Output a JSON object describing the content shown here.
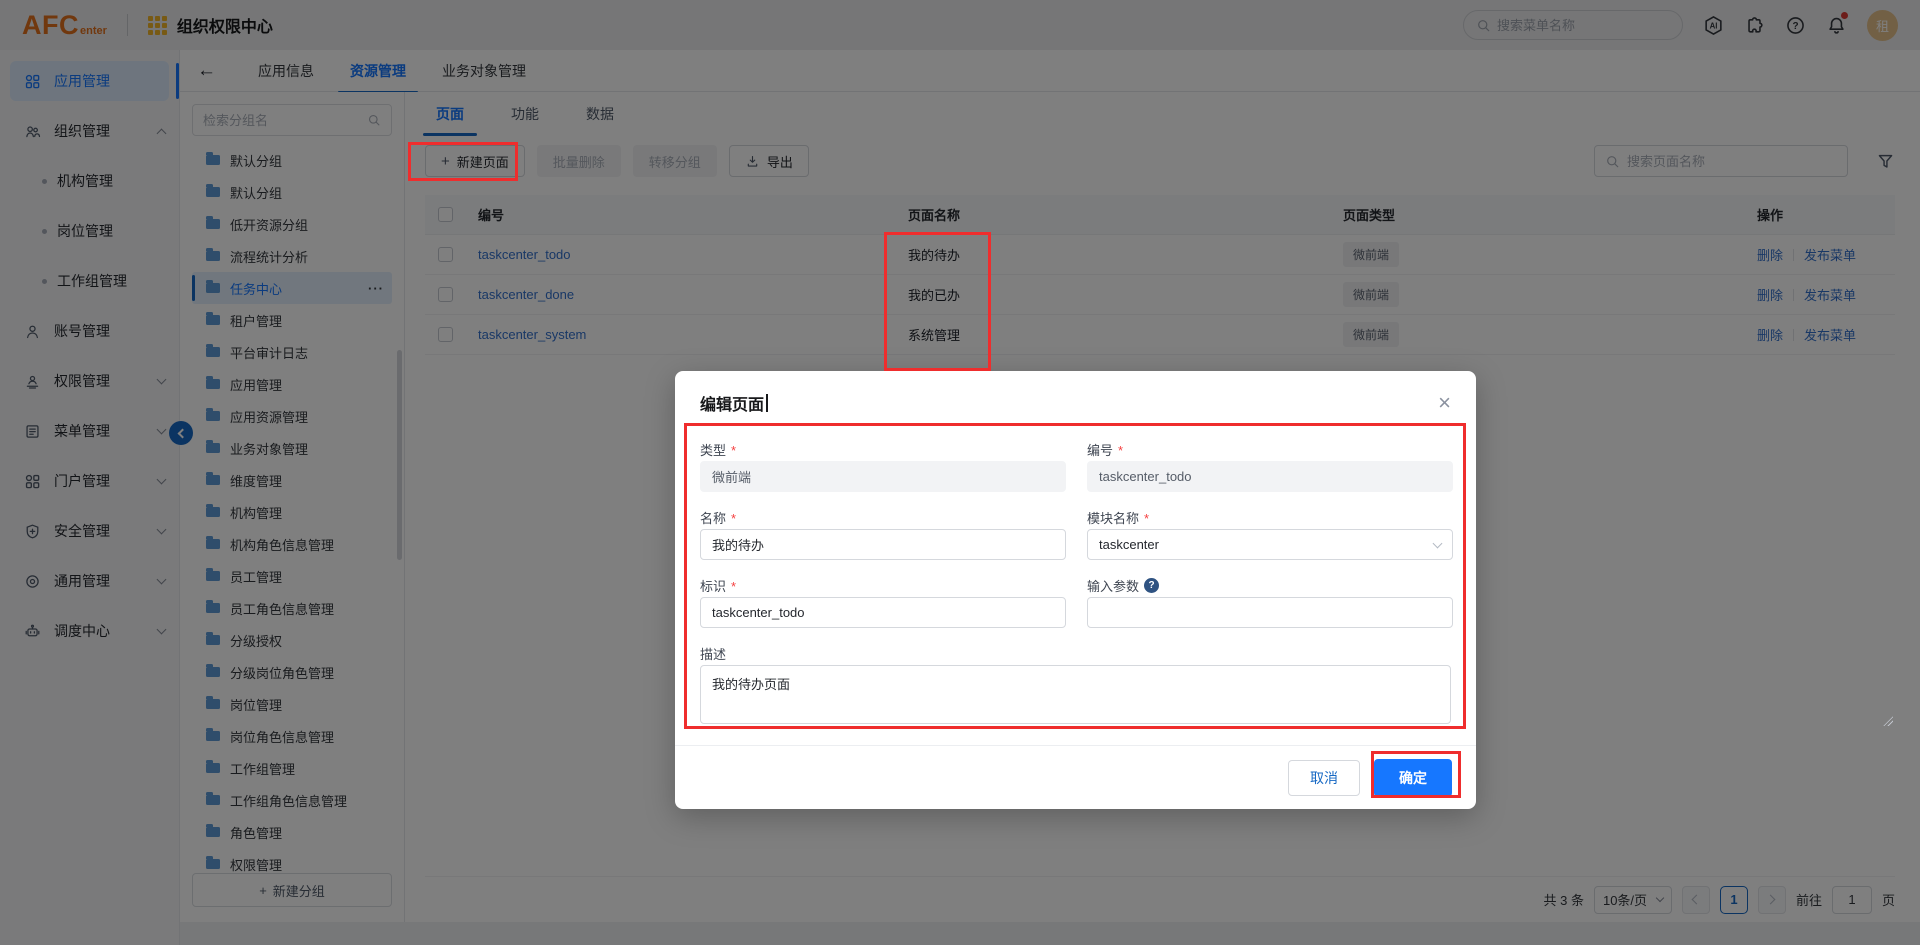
{
  "colors": {
    "accent": "#1677ff",
    "annotation": "#ef2d2d",
    "logo_orange": "#e2711d",
    "grid_gold": "#f0b428",
    "folder_blue": "#5e9bd6",
    "avatar_tan": "#e4c08a"
  },
  "icons": {
    "back": "←",
    "close": "×",
    "plus": "+",
    "more": "···",
    "question_mark": "?",
    "collapse": "chevron-left-circle",
    "search": "magnifier",
    "notification": "bell",
    "help": "question-circle",
    "plugin": "puzzle",
    "assistant": "ai-hexagon",
    "filter": "funnel",
    "export": "download-arrow"
  },
  "header": {
    "logo_afc": "AFC",
    "logo_enter": "enter",
    "app_title": "组织权限中心",
    "search_placeholder": "搜索菜单名称",
    "avatar_text": "租"
  },
  "sidebar": {
    "items": [
      {
        "label": "应用管理"
      },
      {
        "label": "组织管理"
      },
      {
        "label": "机构管理"
      },
      {
        "label": "岗位管理"
      },
      {
        "label": "工作组管理"
      },
      {
        "label": "账号管理"
      },
      {
        "label": "权限管理"
      },
      {
        "label": "菜单管理"
      },
      {
        "label": "门户管理"
      },
      {
        "label": "安全管理"
      },
      {
        "label": "通用管理"
      },
      {
        "label": "调度中心"
      }
    ]
  },
  "tabs": [
    "应用信息",
    "资源管理",
    "业务对象管理"
  ],
  "panel": {
    "search_placeholder": "检索分组名",
    "groups": [
      "默认分组",
      "默认分组",
      "低开资源分组",
      "流程统计分析",
      "任务中心",
      "租户管理",
      "平台审计日志",
      "应用管理",
      "应用资源管理",
      "业务对象管理",
      "维度管理",
      "机构管理",
      "机构角色信息管理",
      "员工管理",
      "员工角色信息管理",
      "分级授权",
      "分级岗位角色管理",
      "岗位管理",
      "岗位角色信息管理",
      "工作组管理",
      "工作组角色信息管理",
      "角色管理",
      "权限管理"
    ],
    "selected": "任务中心",
    "new_group": "新建分组"
  },
  "content": {
    "subtabs": [
      "页面",
      "功能",
      "数据"
    ],
    "toolbar": {
      "new_page": "新建页面",
      "batch_delete": "批量删除",
      "move_group": "转移分组",
      "export": "导出"
    },
    "search_placeholder": "搜索页面名称",
    "table": {
      "headers": [
        "编号",
        "页面名称",
        "页面类型",
        "操作"
      ],
      "rows": [
        {
          "code": "taskcenter_todo",
          "name": "我的待办",
          "type": "微前端",
          "actions": [
            "删除",
            "发布菜单"
          ]
        },
        {
          "code": "taskcenter_done",
          "name": "我的已办",
          "type": "微前端",
          "actions": [
            "删除",
            "发布菜单"
          ]
        },
        {
          "code": "taskcenter_system",
          "name": "系统管理",
          "type": "微前端",
          "actions": [
            "删除",
            "发布菜单"
          ]
        }
      ]
    },
    "pagination": {
      "total": "共 3 条",
      "page_size": "10条/页",
      "current_page": "1",
      "goto_label": "前往",
      "goto_value": "1",
      "page_suffix": "页"
    }
  },
  "modal": {
    "title": "编辑页面",
    "fields": {
      "type_label": "类型",
      "type_value": "微前端",
      "code_label": "编号",
      "code_value": "taskcenter_todo",
      "name_label": "名称",
      "name_value": "我的待办",
      "module_label": "模块名称",
      "module_value": "taskcenter",
      "identifier_label": "标识",
      "identifier_value": "taskcenter_todo",
      "params_label": "输入参数",
      "params_value": "",
      "desc_label": "描述",
      "desc_value": "我的待办页面"
    },
    "cancel": "取消",
    "confirm": "确定"
  }
}
